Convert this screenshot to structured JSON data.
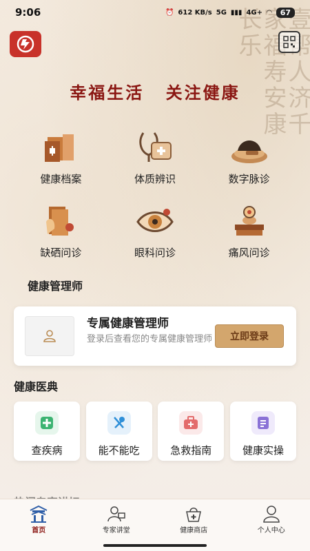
{
  "status": {
    "time": "9:06",
    "net_speed": "612 KB/s",
    "signal": "5G",
    "signal2": "4G+",
    "battery": "67"
  },
  "slogan": {
    "part1": "幸福生活",
    "part2": "关注健康"
  },
  "grid": [
    {
      "label": "健康档案",
      "icon": "health-record-icon"
    },
    {
      "label": "体质辨识",
      "icon": "constitution-icon"
    },
    {
      "label": "数字脉诊",
      "icon": "pulse-diagnosis-icon"
    },
    {
      "label": "缺硒问诊",
      "icon": "selenium-consult-icon"
    },
    {
      "label": "眼科问诊",
      "icon": "eye-consult-icon"
    },
    {
      "label": "痛风问诊",
      "icon": "gout-consult-icon"
    }
  ],
  "manager": {
    "section_title": "健康管理师",
    "card_title": "专属健康管理师",
    "card_desc": "登录后查看您的专属健康管理师",
    "login_label": "立即登录"
  },
  "dict": {
    "section_title": "健康医典",
    "items": [
      {
        "label": "查疾病",
        "icon": "medical-cross-icon",
        "color": "#3cb371",
        "bg": "#e6f6ec"
      },
      {
        "label": "能不能吃",
        "icon": "utensils-icon",
        "color": "#2f8fd8",
        "bg": "#e5f1fb"
      },
      {
        "label": "急救指南",
        "icon": "first-aid-icon",
        "color": "#e36b6b",
        "bg": "#fbe9e9"
      },
      {
        "label": "健康实操",
        "icon": "document-icon",
        "color": "#8a72d6",
        "bg": "#efeafb"
      }
    ]
  },
  "next_section": "热门专家讲坛",
  "tabs": [
    {
      "label": "首页",
      "icon": "home-pavilion-icon",
      "active": true
    },
    {
      "label": "专家讲堂",
      "icon": "expert-lecture-icon",
      "active": false
    },
    {
      "label": "健康商店",
      "icon": "shop-basket-icon",
      "active": false
    },
    {
      "label": "个人中心",
      "icon": "user-profile-icon",
      "active": false
    }
  ],
  "colors": {
    "accent": "#8a1612",
    "brand": "#c8322a",
    "button": "#d3a66d"
  }
}
